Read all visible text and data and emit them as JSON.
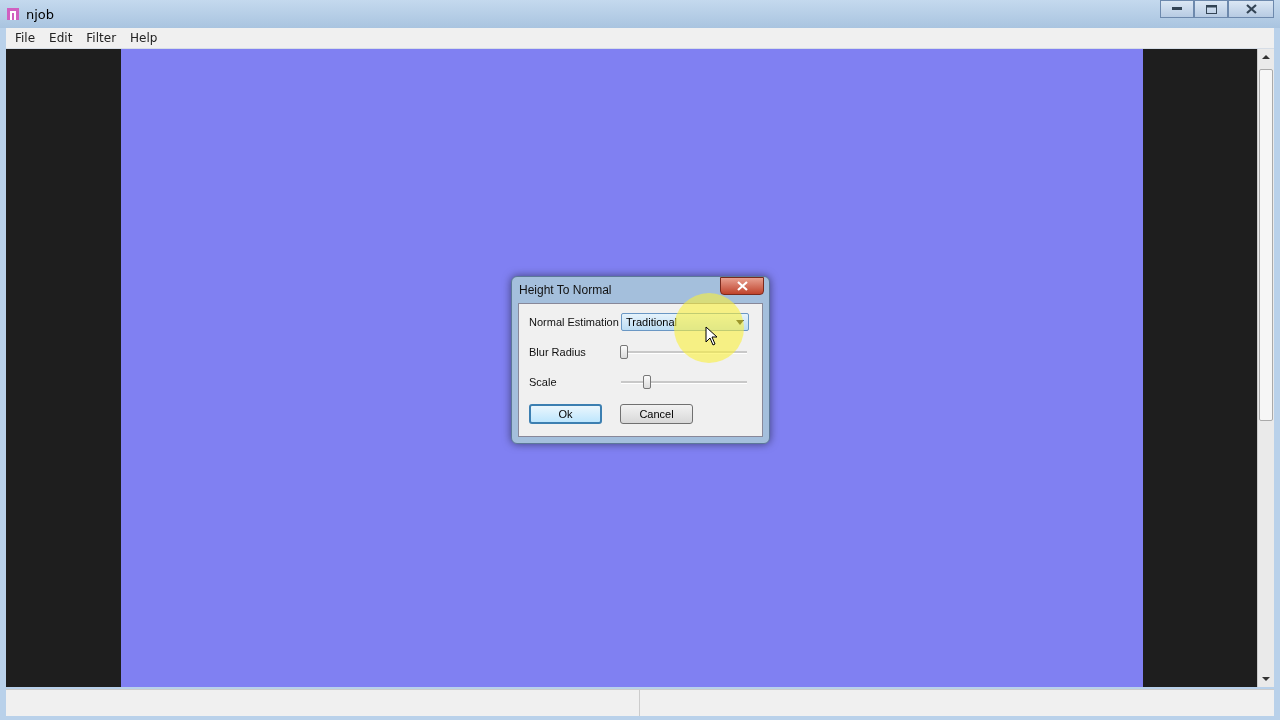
{
  "window": {
    "title": "njob"
  },
  "menu": [
    "File",
    "Edit",
    "Filter",
    "Help"
  ],
  "dialog": {
    "title": "Height To Normal",
    "fields": [
      {
        "kind": "dropdown",
        "label": "Normal Estimation",
        "value": "Traditional"
      },
      {
        "kind": "slider",
        "label": "Blur Radius",
        "level": 0.02
      },
      {
        "kind": "slider",
        "label": "Scale",
        "level": 0.21
      }
    ],
    "buttons": [
      {
        "label": "Ok",
        "default": true
      },
      {
        "label": "Cancel",
        "default": false
      }
    ]
  }
}
